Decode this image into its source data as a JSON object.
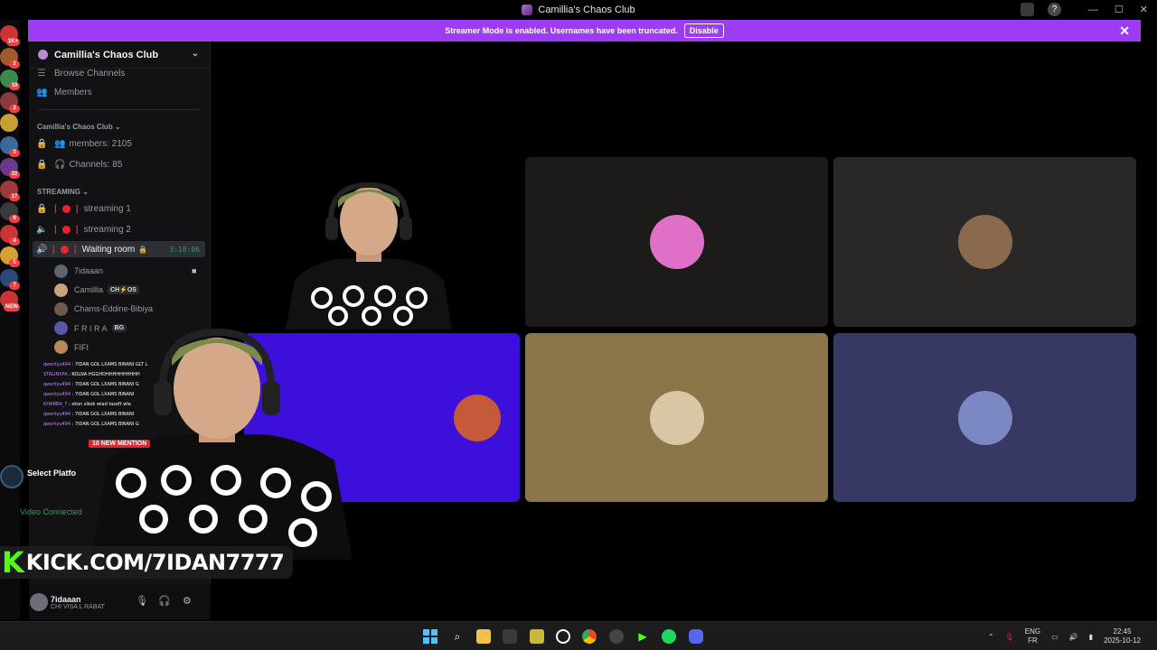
{
  "window": {
    "title": "Camillia's Chaos Club"
  },
  "banner": {
    "text": "Streamer Mode is enabled. Usernames have been truncated.",
    "disable_label": "Disable",
    "close_glyph": "✕"
  },
  "servers": {
    "badges": [
      "1K+",
      "2",
      "10",
      "2",
      "",
      "3",
      "22",
      "17",
      "9",
      "4",
      "5",
      "7",
      "NEW"
    ]
  },
  "guild": {
    "name": "Camillia's Chaos Club",
    "browse_label": "Browse Channels",
    "members_label": "Members",
    "category_main": "Camillia's Chaos Club",
    "stat_members": "members: 2105",
    "stat_channels": "Channels: 85",
    "category_streaming": "STREAMING",
    "channels": [
      {
        "name": "streaming 1"
      },
      {
        "name": "streaming 2"
      }
    ],
    "active_voice": {
      "name": "Waiting room",
      "timer": "3:18:06"
    },
    "voice_members": [
      {
        "name": "7idaaan",
        "tag": "",
        "color": "#5b6470"
      },
      {
        "name": "Camillia",
        "tag": "CH⚡OS",
        "color": "#c9a27c"
      },
      {
        "name": "Chams-Eddine-Bibiya",
        "tag": "",
        "color": "#6e5a4a"
      },
      {
        "name": "F R I R A",
        "tag": "BG",
        "color": "#5a56a8"
      },
      {
        "name": "FIFI",
        "tag": "",
        "color": "#b88a5a"
      }
    ]
  },
  "user": {
    "name": "7idaaan",
    "status": "CHI VISA L RABAT"
  },
  "tiles": [
    {
      "color": "#1d1b1a",
      "avatar_color": "#e06fc8"
    },
    {
      "color": "#2a2827",
      "avatar_color": "#8a6a4c"
    },
    {
      "color": "#3c0fdb",
      "avatar_color": "#c45a3a"
    },
    {
      "color": "#8c7548",
      "avatar_color": "#d8c6a4"
    },
    {
      "color": "#383864",
      "avatar_color": "#7c88c4"
    }
  ],
  "overlay": {
    "kick_text": "KICK.COM/7IDAN7777",
    "chat": [
      {
        "name": "qwertyu494",
        "msg": "7IDAN GOL LXAMS BINANI GLT L"
      },
      {
        "name": "STALINXFA",
        "msg": "KOLNA HGGHOHHHHHHHHHH"
      },
      {
        "name": "qwertyu494",
        "msg": "7IDAN GOL LXAMS BINANI G"
      },
      {
        "name": "qwertyu494",
        "msg": "7IDAN GOL LXAMS BINANI"
      },
      {
        "name": "KHABBA_7",
        "msg": "xkon sikok wlad tasoft wla"
      },
      {
        "name": "qwertyu494",
        "msg": "7IDAN GOL LXAMS BINANI"
      },
      {
        "name": "qwertyu494",
        "msg": "7IDAN GOL LXAMS BINANI G"
      }
    ],
    "new_mention": "10 NEW MENTION",
    "platform_label": "Select Platfo",
    "video_label": "Video Connected"
  },
  "taskbar": {
    "lang_top": "ENG",
    "lang_bottom": "FR",
    "time": "22:45",
    "date": "2025-10-12"
  }
}
